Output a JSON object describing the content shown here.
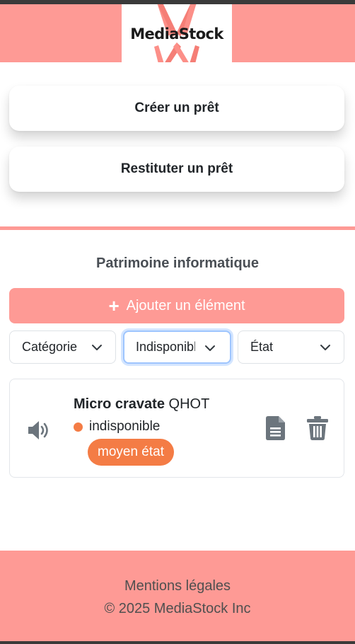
{
  "header": {
    "logo_text": "MediaStock"
  },
  "actions": {
    "create_label": "Créer un prêt",
    "return_label": "Restituter un prêt"
  },
  "inventory": {
    "title": "Patrimoine informatique",
    "add_button": {
      "icon": "plus-icon",
      "label": "Ajouter un élément"
    },
    "filters": {
      "category": "Catégorie",
      "availability": "Indisponible",
      "condition": "État"
    },
    "items": [
      {
        "icon": "speaker-icon",
        "name": "Micro cravate",
        "code": "QHOT",
        "status": "indisponible",
        "status_color": "#f47c45",
        "condition": "moyen état",
        "condition_color": "#f47c45",
        "actions": [
          "document-icon",
          "trash-icon"
        ]
      }
    ]
  },
  "footer": {
    "legal": "Mentions légales",
    "copyright": "© 2025 MediaStock Inc"
  },
  "colors": {
    "brand": "#fe9a95",
    "accent_orange": "#f47c45"
  }
}
